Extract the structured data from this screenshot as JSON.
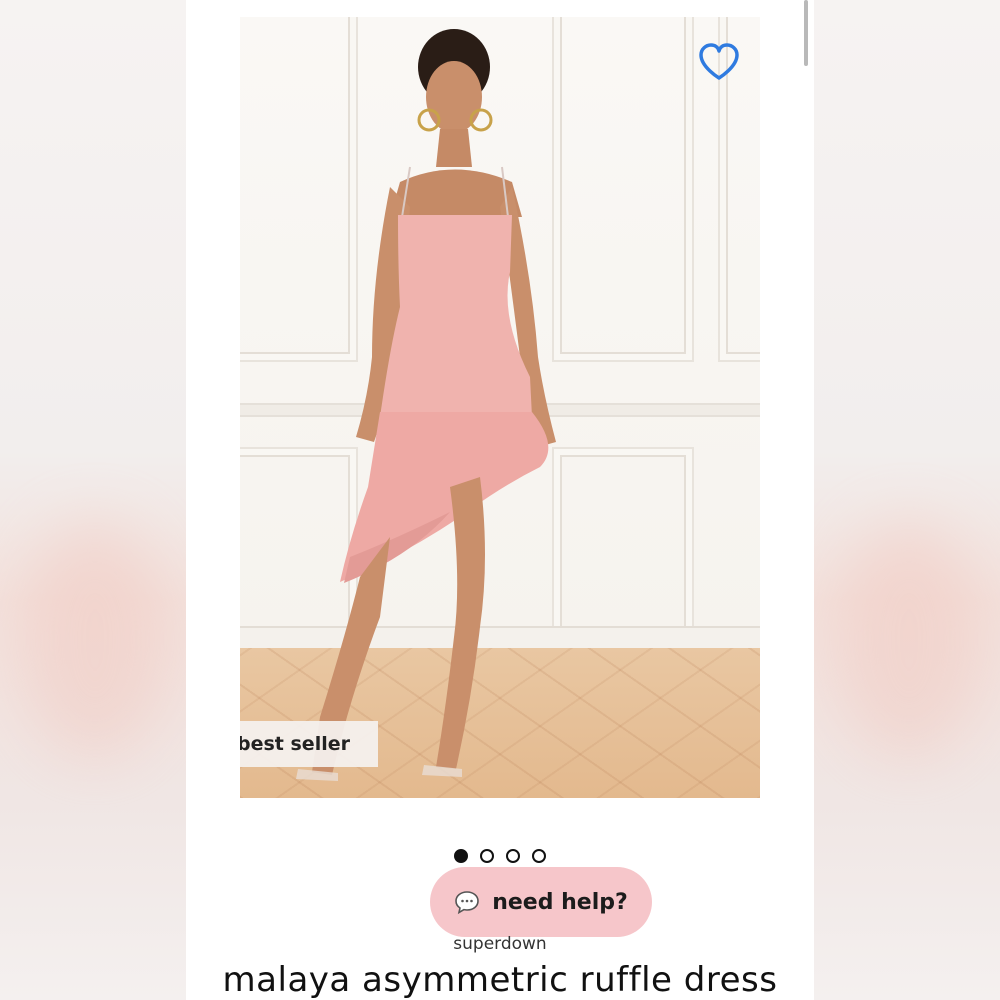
{
  "product": {
    "badge": "best seller",
    "brand": "superdown",
    "title": "malaya asymmetric ruffle dress",
    "favorite_icon": "heart-outline-icon",
    "favorited": false
  },
  "gallery": {
    "image_count": 4,
    "active_index": 0
  },
  "help": {
    "label": "need help?",
    "icon": "chat-bubble-icon"
  },
  "colors": {
    "heart": "#2f7be0",
    "help_bg": "#f6c6ca",
    "dress": "#f0b3ae"
  }
}
